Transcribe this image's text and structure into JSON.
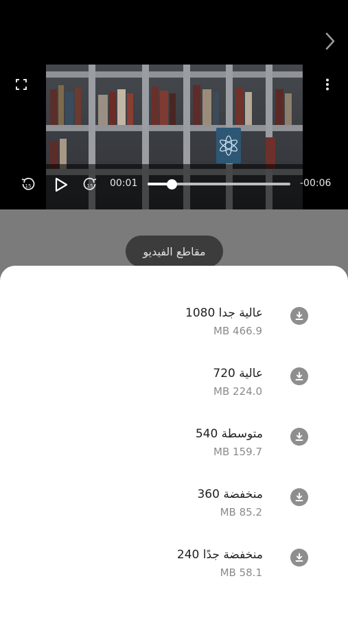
{
  "player": {
    "current_time": "00:01",
    "remaining_time": "-00:06",
    "progress": 0.17,
    "rewind_seconds": "15",
    "forward_seconds": "15"
  },
  "clips_button": {
    "label": "مقاطع الفيديو"
  },
  "download_options": [
    {
      "label": "عالية جدا 1080",
      "size": "MB 466.9"
    },
    {
      "label": "عالية 720",
      "size": "MB 224.0"
    },
    {
      "label": "متوسطة 540",
      "size": "MB 159.7"
    },
    {
      "label": "منخفضة 360",
      "size": "MB 85.2"
    },
    {
      "label": "منخفضة جدًا 240",
      "size": "MB 58.1"
    }
  ],
  "colors": {
    "player_bg": "#000000",
    "dim_overlay": "#7b7b7b",
    "sheet_bg": "#ffffff",
    "download_icon": "#8e8e8e",
    "pill_bg": "#3c3c3c"
  },
  "icons": {
    "next": "chevron-right-icon",
    "fullscreen": "fullscreen-icon",
    "more": "more-vertical-icon",
    "rewind": "rewind-15-icon",
    "play": "play-icon",
    "forward": "forward-15-icon",
    "download": "download-icon"
  }
}
